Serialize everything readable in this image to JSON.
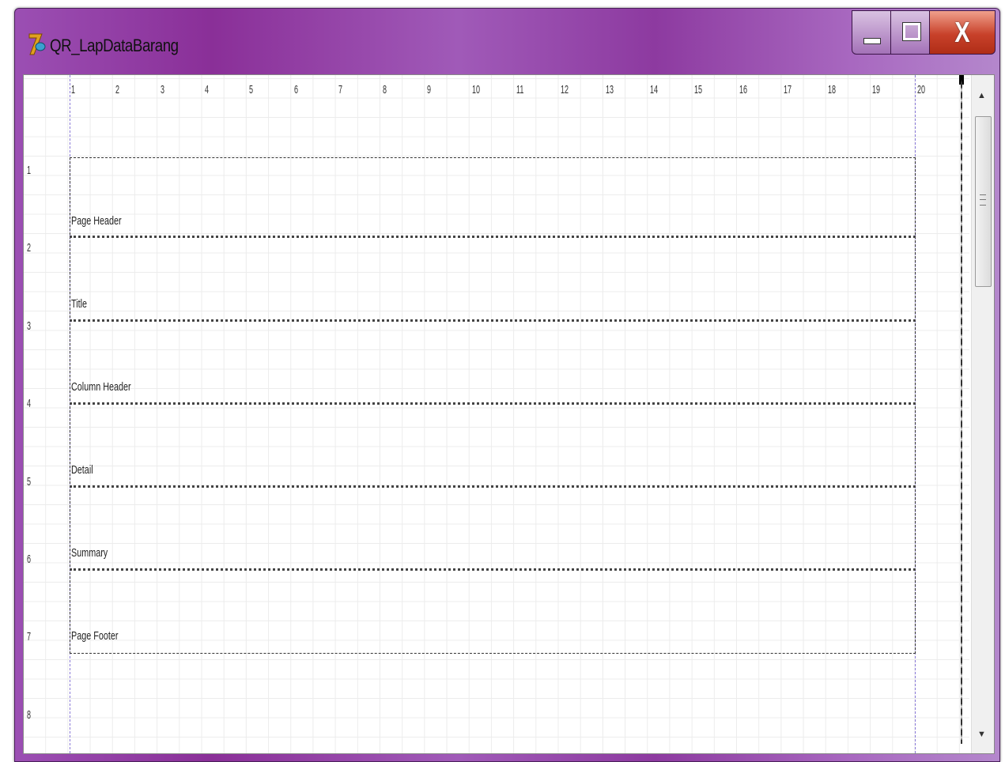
{
  "window": {
    "title": "QR_LapDataBarang",
    "icon": "delphi-icon"
  },
  "controls": {
    "close_label": "X"
  },
  "ruler": {
    "columns": [
      "1",
      "2",
      "3",
      "4",
      "5",
      "6",
      "7",
      "8",
      "9",
      "10",
      "11",
      "12",
      "13",
      "14",
      "15",
      "16",
      "17",
      "18",
      "19",
      "20"
    ],
    "rows": [
      "1",
      "2",
      "3",
      "4",
      "5",
      "6",
      "7",
      "8"
    ]
  },
  "bands": [
    {
      "label": "Page Header"
    },
    {
      "label": "Title"
    },
    {
      "label": "Column Header"
    },
    {
      "label": "Detail"
    },
    {
      "label": "Summary"
    },
    {
      "label": "Page Footer"
    }
  ],
  "colors": {
    "titlebar": "#8d3aa0",
    "close": "#c8412a",
    "grid": "#ececec"
  }
}
